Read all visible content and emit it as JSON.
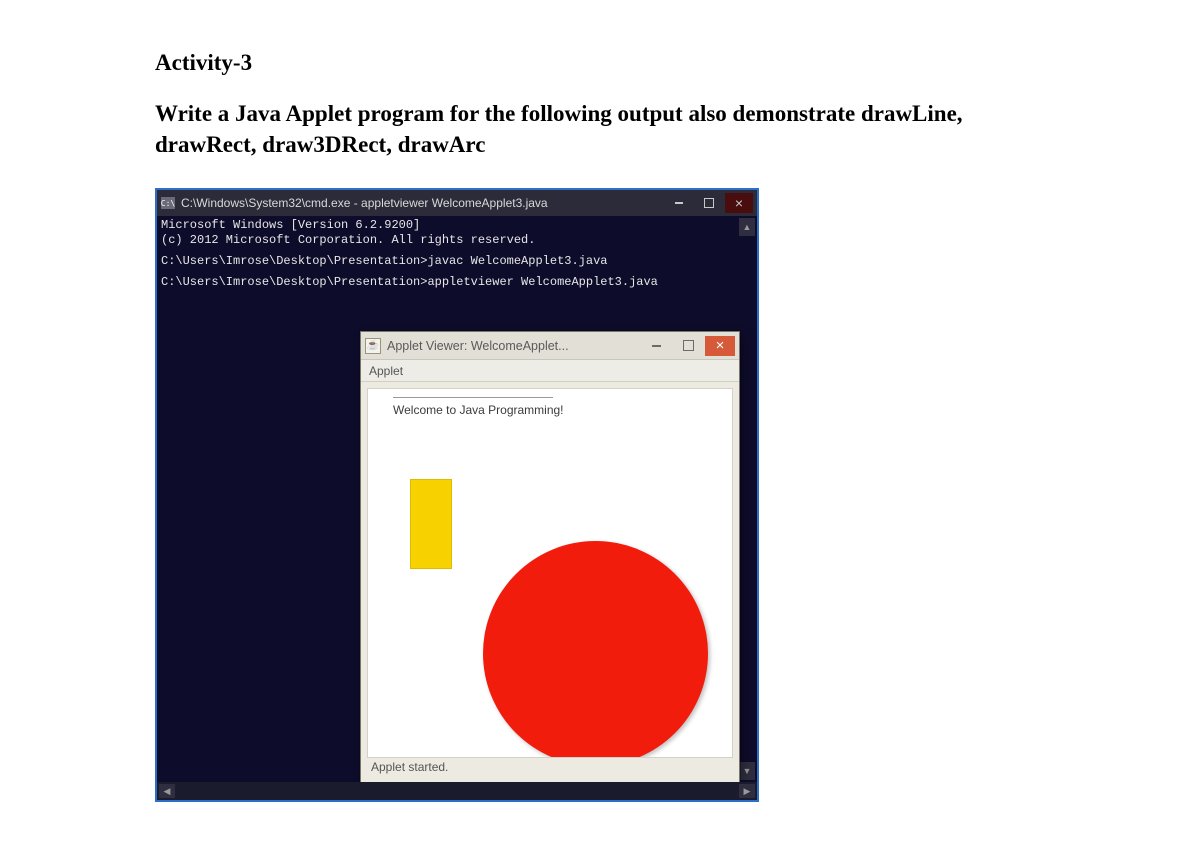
{
  "doc": {
    "heading": "Activity-3",
    "description": "Write a Java Applet program for the following output also demonstrate drawLine, drawRect, draw3DRect, drawArc"
  },
  "cmd": {
    "icon_label": "C:\\",
    "title": "C:\\Windows\\System32\\cmd.exe - appletviewer  WelcomeApplet3.java",
    "lines": {
      "l1": "Microsoft Windows [Version 6.2.9200]",
      "l2": "(c) 2012 Microsoft Corporation. All rights reserved.",
      "l3": "C:\\Users\\Imrose\\Desktop\\Presentation>javac WelcomeApplet3.java",
      "l4": "C:\\Users\\Imrose\\Desktop\\Presentation>appletviewer WelcomeApplet3.java"
    }
  },
  "applet": {
    "title": "Applet Viewer: WelcomeApplet...",
    "menu": "Applet",
    "welcome": "Welcome to Java Programming!",
    "status": "Applet started."
  }
}
